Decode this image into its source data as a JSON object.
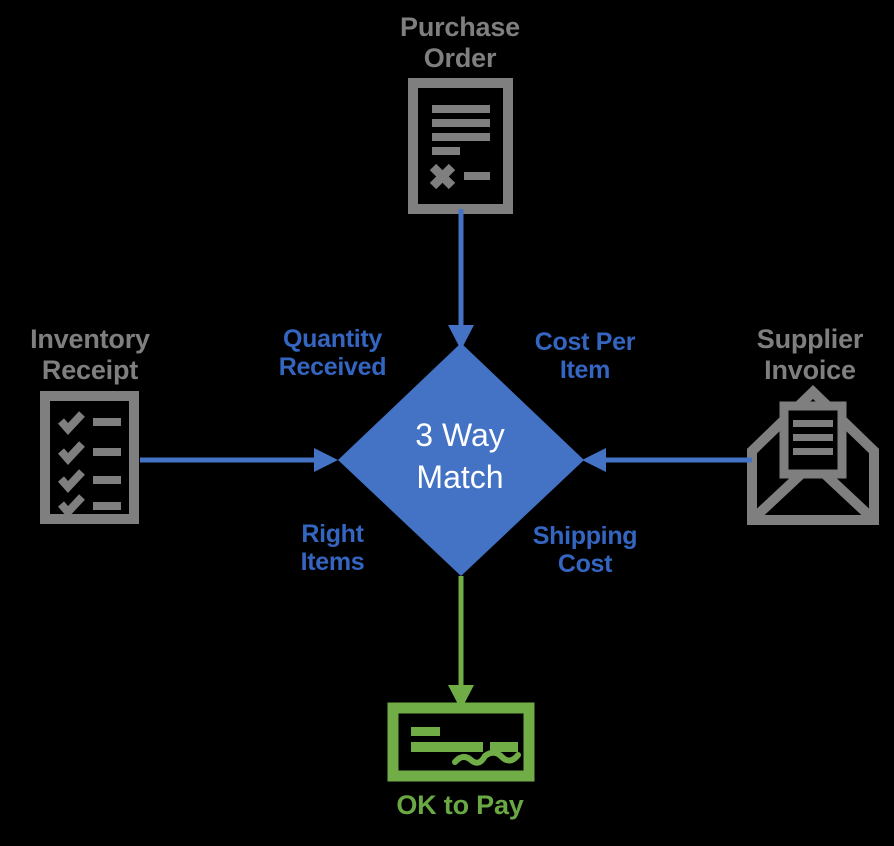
{
  "diagram": {
    "title": "3 Way Match process diagram",
    "background_color": "#000000",
    "colors": {
      "gray": "#7f7f7f",
      "blue_accent": "#4472c4",
      "blue_text": "#3465c0",
      "green": "#70ad47",
      "green_text": "#6aa843",
      "white": "#ffffff"
    },
    "center": {
      "shape": "diamond",
      "label": "3 Way\nMatch",
      "fill": "#4472c4",
      "text_color": "#ffffff"
    },
    "nodes": [
      {
        "id": "purchase-order",
        "label": "Purchase\nOrder",
        "icon": "document-icon",
        "color": "#7f7f7f",
        "position": "top"
      },
      {
        "id": "inventory-receipt",
        "label": "Inventory\nReceipt",
        "icon": "checklist-icon",
        "color": "#7f7f7f",
        "position": "left"
      },
      {
        "id": "supplier-invoice",
        "label": "Supplier\nInvoice",
        "icon": "open-envelope-icon",
        "color": "#7f7f7f",
        "position": "right"
      },
      {
        "id": "ok-to-pay",
        "label": "OK to Pay",
        "icon": "cheque-icon",
        "color": "#70ad47",
        "position": "bottom"
      }
    ],
    "edges": [
      {
        "id": "edge-po-to-match",
        "from": "purchase-order",
        "to": "3-way-match",
        "direction": "down",
        "color": "#4472c4",
        "labels": [
          "Quantity\nReceived",
          "Cost Per\nItem"
        ]
      },
      {
        "id": "edge-ir-to-match",
        "from": "inventory-receipt",
        "to": "3-way-match",
        "direction": "right",
        "color": "#4472c4"
      },
      {
        "id": "edge-si-to-match",
        "from": "supplier-invoice",
        "to": "3-way-match",
        "direction": "left",
        "color": "#4472c4"
      },
      {
        "id": "edge-match-to-pay",
        "from": "3-way-match",
        "to": "ok-to-pay",
        "direction": "down",
        "color": "#70ad47",
        "labels": [
          "Right\nItems",
          "Shipping\nCost"
        ]
      }
    ],
    "edge_labels": {
      "quantity_received": "Quantity\nReceived",
      "cost_per_item": "Cost Per\nItem",
      "right_items": "Right\nItems",
      "shipping_cost": "Shipping\nCost"
    }
  }
}
